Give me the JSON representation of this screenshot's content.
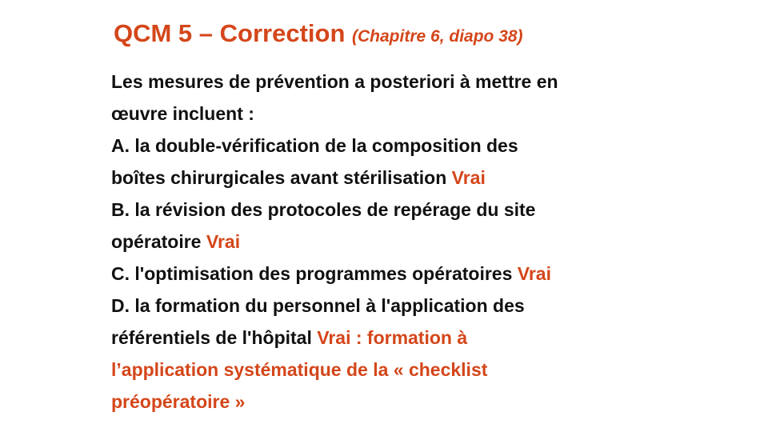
{
  "slide": {
    "title": "QCM 5 – Correction",
    "subtitle": "(Chapitre 6, diapo 38)",
    "question": {
      "line1": "Les mesures de prévention a posteriori à mettre en",
      "line2": "œuvre incluent  :"
    },
    "options": {
      "a": {
        "line1": "A. la double-vérification de la composition des",
        "line2": "boîtes chirurgicales avant stérilisation",
        "answer": "Vrai"
      },
      "b": {
        "line1": "B. la révision des protocoles de repérage du site",
        "line2": "opératoire",
        "answer": "Vrai"
      },
      "c": {
        "line1": "C. l'optimisation des programmes opératoires",
        "answer": "Vrai"
      },
      "d": {
        "line1": "D. la formation du personnel à l'application des",
        "line2": "référentiels de l'hôpital",
        "answer_part1": "Vrai : formation à",
        "answer_part2": "l’application systématique de la « checklist",
        "answer_part3": "préopératoire »"
      }
    },
    "colors": {
      "accent": "#d4461a",
      "text": "#111111",
      "background": "#ffffff"
    }
  }
}
